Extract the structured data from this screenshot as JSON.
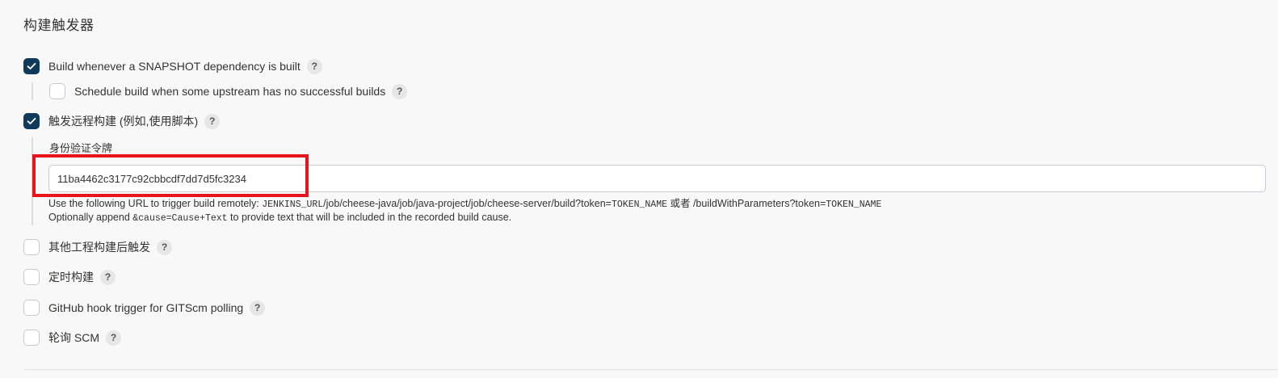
{
  "section": {
    "title": "构建触发器"
  },
  "triggers": [
    {
      "label": "Build whenever a SNAPSHOT dependency is built",
      "checked": true
    },
    {
      "label": "Schedule build when some upstream has no successful builds",
      "checked": false
    },
    {
      "label": "触发远程构建 (例如,使用脚本)",
      "checked": true
    },
    {
      "label": "其他工程构建后触发",
      "checked": false
    },
    {
      "label": "定时构建",
      "checked": false
    },
    {
      "label": "GitHub hook trigger for GITScm polling",
      "checked": false
    },
    {
      "label": "轮询 SCM",
      "checked": false
    }
  ],
  "help_symbol": "?",
  "remote": {
    "token_label": "身份验证令牌",
    "token_value": "11ba4462c3177c92cbbcdf7dd7d5fc3234",
    "url_prefix": "Use the following URL to trigger build remotely: ",
    "url_var": "JENKINS_URL",
    "url_path": "/job/cheese-java/job/java-project/job/cheese-server/build?token=",
    "token_name": "TOKEN_NAME",
    "or_text": " 或者 ",
    "with_params": "/buildWithParameters?token=",
    "cause_prefix": "Optionally append ",
    "cause_code": "&cause=Cause+Text",
    "cause_suffix": " to provide text that will be included in the recorded build cause."
  },
  "colors": {
    "checkbox_checked": "#103a5c",
    "highlight": "#e8141b",
    "background": "#f8f8f8"
  }
}
